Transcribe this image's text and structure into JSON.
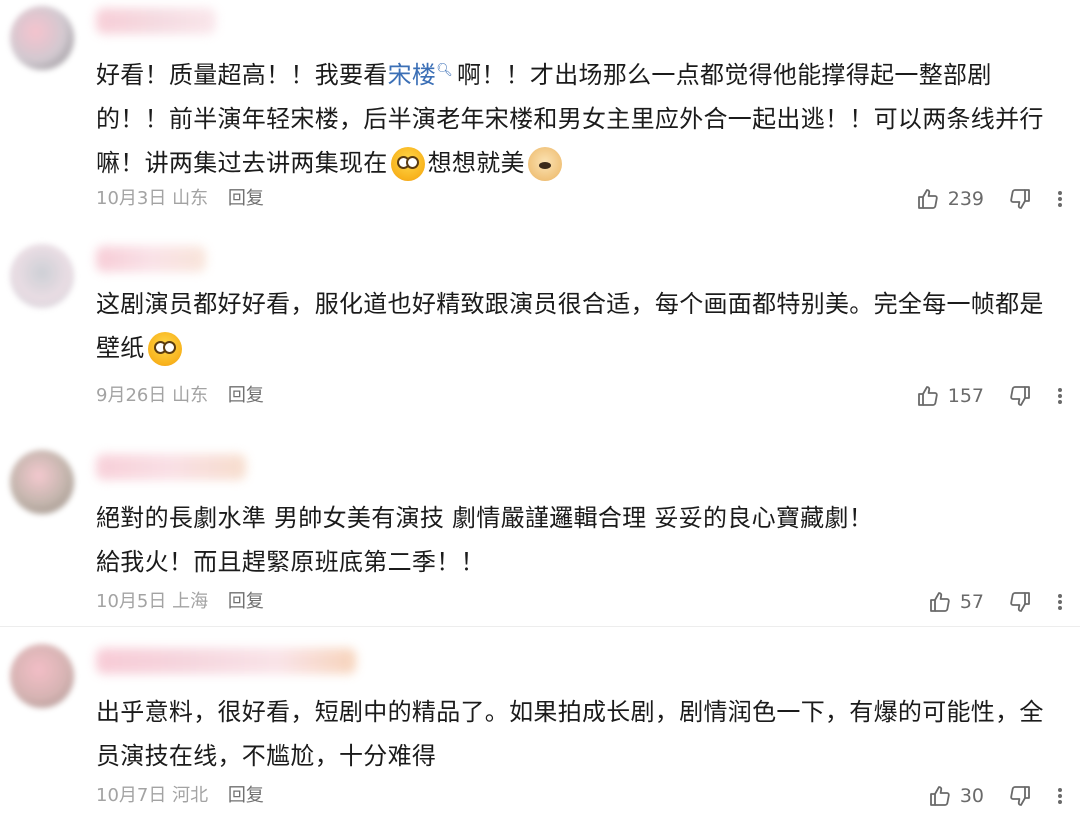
{
  "comments": [
    {
      "text_before_link": "好看！质量超高！！我要看",
      "link": "宋楼",
      "text_after_link": "啊！！才出场那么一点都觉得他能撑得起一整部剧的！！前半演年轻宋楼，后半演老年宋楼和男女主里应外合一起出逃！！可以两条线并行嘛！讲两集过去讲两集现在",
      "text_tail": "想想就美",
      "date": "10月3日",
      "location": "山东",
      "reply": "回复",
      "likes": "239"
    },
    {
      "text": "这剧演员都好好看，服化道也好精致跟演员很合适，每个画面都特别美。完全每一帧都是壁纸",
      "date": "9月26日",
      "location": "山东",
      "reply": "回复",
      "likes": "157"
    },
    {
      "text_line1": "絕對的長劇水準 男帥女美有演技 劇情嚴謹邏輯合理 妥妥的良心寶藏劇！",
      "text_line2": "給我火！而且趕緊原班底第二季！！",
      "date": "10月5日",
      "location": "上海",
      "reply": "回复",
      "likes": "57"
    },
    {
      "text": "出乎意料，很好看，短剧中的精品了。如果拍成长剧，剧情润色一下，有爆的可能性，全员演技在线，不尴尬，十分难得",
      "date": "10月7日",
      "location": "河北",
      "reply": "回复",
      "likes": "30"
    }
  ],
  "icons": {
    "like": "thumbs-up-icon",
    "dislike": "thumbs-down-icon",
    "more": "more-vertical-icon",
    "emoji_wow": "wow-face-emoji-icon",
    "emoji_doge": "doge-emoji-icon",
    "search_hint": "search-icon"
  },
  "colors": {
    "link": "#3b6fb6",
    "meta": "#a3a3a3",
    "text": "#1b1b1b"
  }
}
